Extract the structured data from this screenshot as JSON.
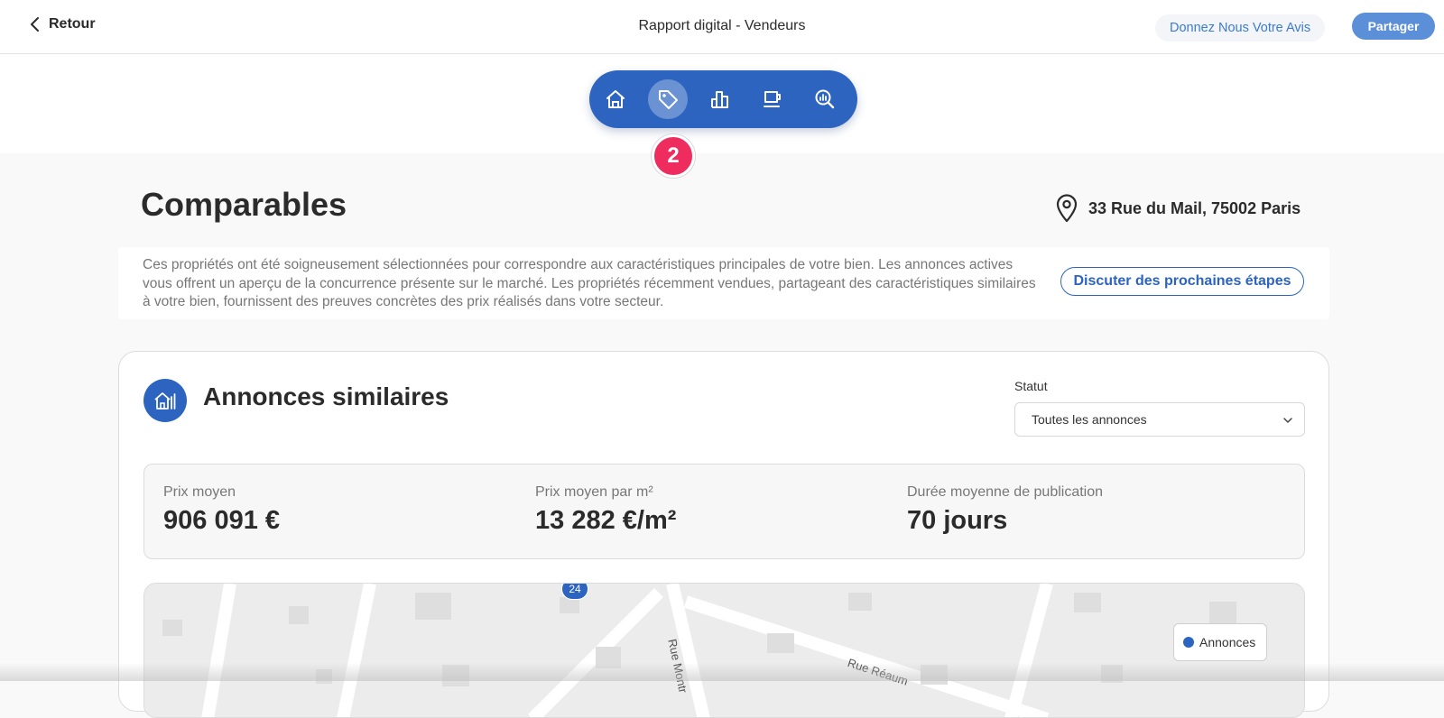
{
  "header": {
    "back_label": "Retour",
    "title": "Rapport digital - Vendeurs",
    "feedback_label": "Donnez Nous Votre Avis",
    "share_label": "Partager"
  },
  "nav": {
    "items": [
      {
        "icon": "home-icon"
      },
      {
        "icon": "tag-icon",
        "active": true
      },
      {
        "icon": "bar-chart-icon"
      },
      {
        "icon": "coffee-cup-icon"
      },
      {
        "icon": "search-chart-icon"
      }
    ],
    "step_badge": "2",
    "accent": "#2c64c0",
    "badge_color": "#ee2c5e"
  },
  "section": {
    "title": "Comparables",
    "address": "33 Rue du Mail, 75002 Paris",
    "intro": "Ces propriétés ont été soigneusement sélectionnées pour correspondre aux caractéristiques principales de votre bien. Les annonces actives vous offrent un aperçu de la concurrence présente sur le marché. Les propriétés récemment vendues, partageant des caractéristiques similaires à votre bien, fournissent des preuves concrètes des prix réalisés dans votre secteur.",
    "next_steps_label": "Discuter des prochaines étapes"
  },
  "card": {
    "title": "Annonces similaires",
    "status_label": "Statut",
    "status_value": "Toutes les annonces",
    "stats": [
      {
        "label": "Prix moyen",
        "value": "906 091 €"
      },
      {
        "label": "Prix moyen par m²",
        "value": "13 282 €/m²"
      },
      {
        "label": "Durée moyenne de publication",
        "value": "70 jours"
      }
    ]
  },
  "map": {
    "marker_label": "24",
    "streets": [
      "Rue Montr",
      "Rue Réaum"
    ],
    "legend_label": "Annonces"
  }
}
